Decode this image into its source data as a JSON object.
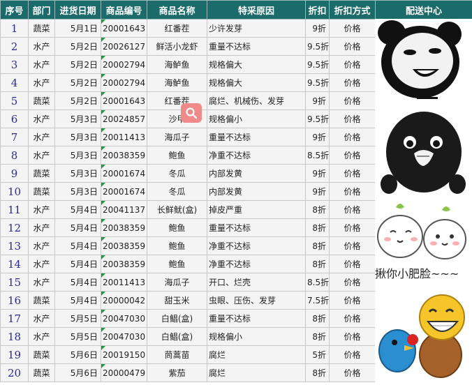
{
  "headers": [
    "序号",
    "部门",
    "进货日期",
    "商品编号",
    "商品名称",
    "特采原因",
    "折扣",
    "折扣方式",
    "配送中心"
  ],
  "rows": [
    [
      "1",
      "蔬菜",
      "5月1日",
      "20001643",
      "红番茬",
      "少许发芽",
      "9折",
      "价格"
    ],
    [
      "2",
      "水产",
      "5月2日",
      "20026127",
      "鲜活小龙虾",
      "重量不达标",
      "9.5折",
      "价格"
    ],
    [
      "3",
      "水产",
      "5月2日",
      "20002794",
      "海鲈鱼",
      "规格偏大",
      "9.5折",
      "价格"
    ],
    [
      "4",
      "水产",
      "5月2日",
      "20002794",
      "海鲈鱼",
      "规格偏大",
      "9.5折",
      "价格"
    ],
    [
      "5",
      "蔬菜",
      "5月2日",
      "20001643",
      "红番茬",
      "腐烂、机械伤、发芽",
      "9折",
      "价格"
    ],
    [
      "6",
      "水产",
      "5月3日",
      "20024857",
      "沙甲",
      "规格偏小",
      "9.5折",
      "价格"
    ],
    [
      "7",
      "水产",
      "5月3日",
      "20011413",
      "海瓜子",
      "重量不达标",
      "9折",
      "价格"
    ],
    [
      "8",
      "水产",
      "5月3日",
      "20038359",
      "鲍鱼",
      "净重不达标",
      "8.5折",
      "价格"
    ],
    [
      "9",
      "蔬菜",
      "5月3日",
      "20001674",
      "冬瓜",
      "内部发黄",
      "9折",
      "价格"
    ],
    [
      "10",
      "蔬菜",
      "5月3日",
      "20001674",
      "冬瓜",
      "内部发黄",
      "9折",
      "价格"
    ],
    [
      "11",
      "水产",
      "5月4日",
      "20041137",
      "长鲜鱿(盒)",
      "掉皮严重",
      "8折",
      "价格"
    ],
    [
      "12",
      "水产",
      "5月4日",
      "20038359",
      "鲍鱼",
      "重量不达标",
      "8折",
      "价格"
    ],
    [
      "13",
      "水产",
      "5月4日",
      "20038359",
      "鲍鱼",
      "净重不达标",
      "8折",
      "价格"
    ],
    [
      "14",
      "水产",
      "5月4日",
      "20038359",
      "鲍鱼",
      "净重不达标",
      "8折",
      "价格"
    ],
    [
      "15",
      "水产",
      "5月4日",
      "20011413",
      "海瓜子",
      "开口、烂壳",
      "8.5折",
      "价格"
    ],
    [
      "16",
      "蔬菜",
      "5月4日",
      "20000042",
      "甜玉米",
      "虫眼、压伤、发芽",
      "7.5折",
      "价格"
    ],
    [
      "17",
      "水产",
      "5月5日",
      "20047030",
      "白鲳(盒)",
      "重量不达标",
      "8折",
      "价格"
    ],
    [
      "18",
      "水产",
      "5月5日",
      "20047030",
      "白鲳(盒)",
      "规格偏小",
      "8折",
      "价格"
    ],
    [
      "19",
      "蔬菜",
      "5月6日",
      "20019150",
      "茼蒿苗",
      "腐烂",
      "5折",
      "价格"
    ],
    [
      "20",
      "蔬菜",
      "5月6日",
      "20000479",
      "紫茄",
      "腐烂",
      "8折",
      "价格"
    ]
  ],
  "sticker_caption": "揪你小肥脸~~~",
  "colors": {
    "header_bg": "#1b6b6b",
    "index_text": "#2a2a9a",
    "corner_marker": "#1a9a3a",
    "search_button": "#f08a8a"
  }
}
